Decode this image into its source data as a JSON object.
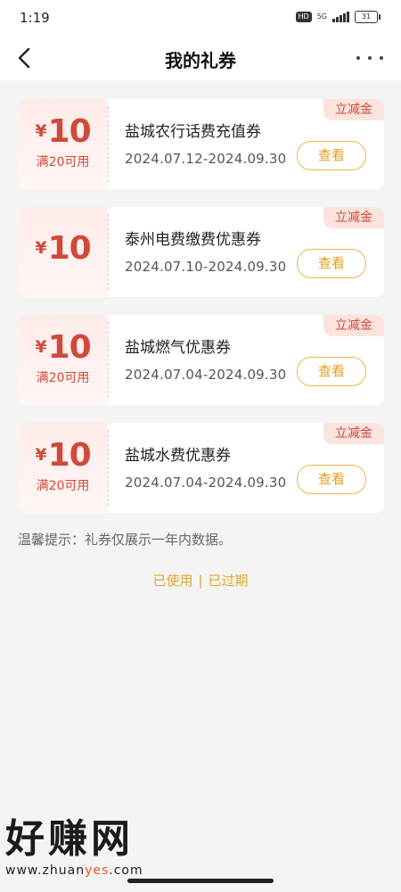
{
  "status_bar": {
    "time": "1:19",
    "hd": "HD",
    "network": "5G",
    "battery": "31"
  },
  "nav": {
    "title": "我的礼券",
    "back_icon": "chevron-left-icon",
    "more_icon": "more-horizontal-icon"
  },
  "coupons": [
    {
      "currency": "¥",
      "amount": "10",
      "threshold": "满20可用",
      "name": "盐城农行话费充值券",
      "date_range": "2024.07.12-2024.09.30",
      "tag": "立减金",
      "button": "查看"
    },
    {
      "currency": "¥",
      "amount": "10",
      "threshold": "",
      "name": "泰州电费缴费优惠券",
      "date_range": "2024.07.10-2024.09.30",
      "tag": "立减金",
      "button": "查看"
    },
    {
      "currency": "¥",
      "amount": "10",
      "threshold": "满20可用",
      "name": "盐城燃气优惠券",
      "date_range": "2024.07.04-2024.09.30",
      "tag": "立减金",
      "button": "查看"
    },
    {
      "currency": "¥",
      "amount": "10",
      "threshold": "满20可用",
      "name": "盐城水费优惠券",
      "date_range": "2024.07.04-2024.09.30",
      "tag": "立减金",
      "button": "查看"
    }
  ],
  "tip": "温馨提示：礼券仅展示一年内数据。",
  "links": {
    "used": "已使用",
    "separator": "|",
    "expired": "已过期"
  },
  "watermark": {
    "brand": "好赚网",
    "url_prefix": "www.zhuan",
    "url_highlight": "yes",
    "url_suffix": ".com"
  },
  "colors": {
    "accent_red": "#cf4a3a",
    "accent_orange": "#e89c1c",
    "tag_bg": "#fbe3de"
  }
}
